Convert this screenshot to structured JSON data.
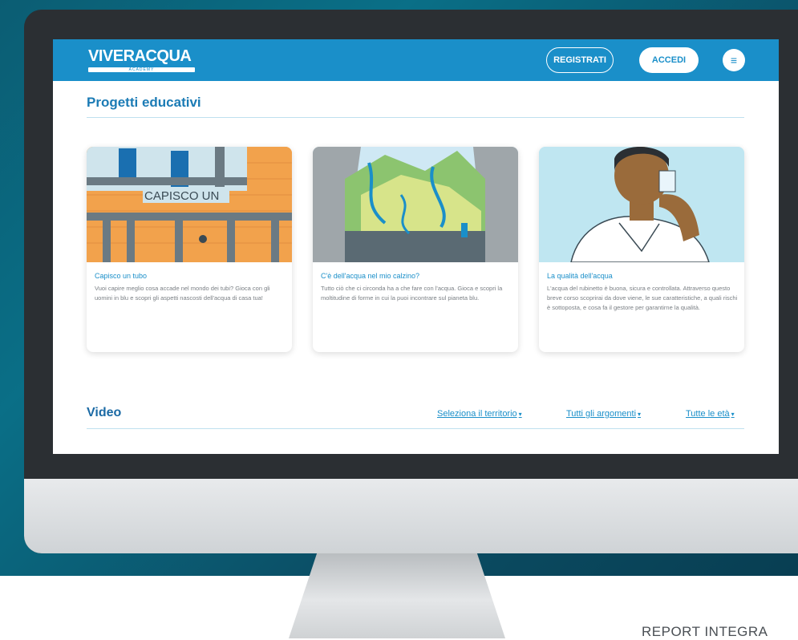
{
  "header": {
    "logo": "VIVERACQUA",
    "logo_sub": "ACADEMY",
    "register_label": "REGISTRATI",
    "login_label": "ACCEDI",
    "menu_icon": "hamburger-icon"
  },
  "projects": {
    "title": "Progetti educativi",
    "cards": [
      {
        "title": "Capisco un tubo",
        "description": "Vuoi capire meglio cosa accade nel mondo dei tubi? Gioca con gli uomini in blu e scopri gli aspetti nascosti dell'acqua di casa tua!",
        "image_text": "CAPISCO UN TUBO"
      },
      {
        "title": "C'è dell'acqua nel mio calzino?",
        "description": "Tutto ciò che ci circonda ha a che fare con l'acqua. Gioca e scopri la moltitudine di forme in cui la puoi incontrare sul pianeta blu."
      },
      {
        "title": "La qualità dell'acqua",
        "description": "L'acqua del rubinetto è buona, sicura e controllata. Attraverso questo breve corso scoprirai da dove viene, le sue caratteristiche, a quali rischi è sottoposta, e cosa fa il gestore per garantirne la qualità."
      }
    ]
  },
  "video": {
    "title": "Video",
    "filters": [
      "Seleziona il territorio",
      "Tutti gli argomenti",
      "Tutte le età"
    ]
  },
  "footer_text": "REPORT INTEGRA",
  "colors": {
    "brand_blue": "#1a8fc9",
    "title_blue": "#1b7bb5",
    "background_teal": "#0b5d73"
  }
}
